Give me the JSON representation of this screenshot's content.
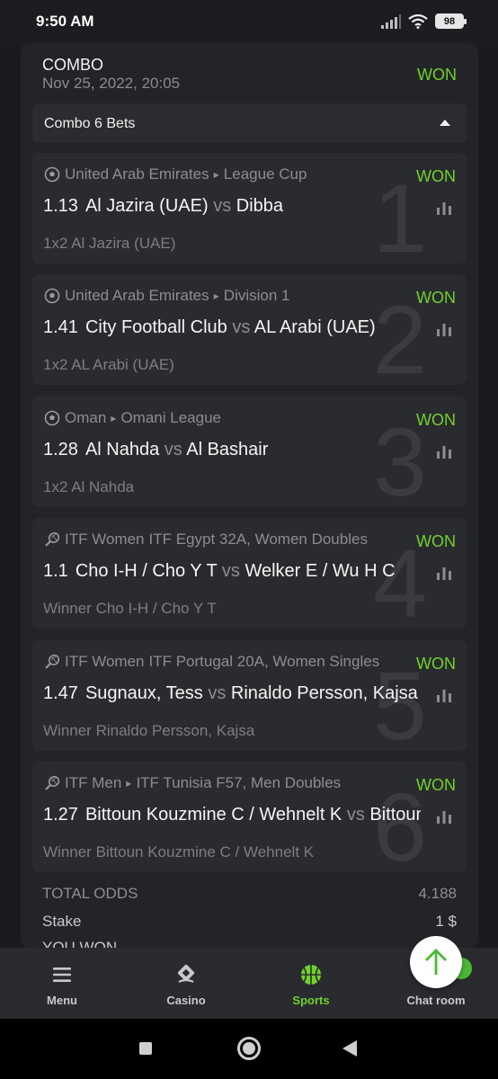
{
  "status": {
    "time": "9:50 AM",
    "battery": "98"
  },
  "combo": {
    "title": "COMBO",
    "date": "Nov 25, 2022, 20:05",
    "status": "WON",
    "bets_label": "Combo 6 Bets"
  },
  "bets": [
    {
      "number": "1",
      "sport_icon": "soccer-ball-icon",
      "country": "United Arab Emirates",
      "league": "League Cup",
      "status": "WON",
      "odd": "1.13",
      "home": "Al Jazira (UAE)",
      "vs": "vs",
      "away": "Dibba",
      "pick": "1x2 Al Jazira (UAE)"
    },
    {
      "number": "2",
      "sport_icon": "soccer-ball-icon",
      "country": "United Arab Emirates",
      "league": "Division 1",
      "status": "WON",
      "odd": "1.41",
      "home": "City Football Club",
      "vs": "vs",
      "away": "AL Arabi (UAE)",
      "pick": "1x2 AL Arabi (UAE)"
    },
    {
      "number": "3",
      "sport_icon": "soccer-ball-icon",
      "country": "Oman",
      "league": "Omani League",
      "status": "WON",
      "odd": "1.28",
      "home": "Al Nahda",
      "vs": "vs",
      "away": "Al Bashair",
      "pick": "1x2 Al Nahda"
    },
    {
      "number": "4",
      "sport_icon": "tennis-racket-icon",
      "country": "ITF Women",
      "league": "ITF Egypt 32A, Women Doubles",
      "status": "WON",
      "odd": "1.1",
      "home": "Cho I-H / Cho Y T",
      "vs": "vs",
      "away": "Welker E / Wu H C",
      "pick": "Winner Cho I-H / Cho Y T"
    },
    {
      "number": "5",
      "sport_icon": "tennis-racket-icon",
      "country": "ITF Women",
      "league": "ITF Portugal 20A, Women Singles",
      "status": "WON",
      "odd": "1.47",
      "home": "Sugnaux, Tess",
      "vs": "vs",
      "away": "Rinaldo Persson, Kajsa",
      "pick": "Winner Rinaldo Persson, Kajsa"
    },
    {
      "number": "6",
      "sport_icon": "tennis-racket-icon",
      "country": "ITF Men",
      "league": "ITF Tunisia F57, Men Doubles",
      "status": "WON",
      "odd": "1.27",
      "home": "Bittoun Kouzmine C / Wehnelt K",
      "vs": "vs",
      "away": "Bittoun Kouzmine C",
      "pick": "Winner Bittoun Kouzmine C / Wehnelt K"
    }
  ],
  "totals": {
    "odds_label": "TOTAL ODDS",
    "odds_value": "4.188",
    "stake_label": "Stake",
    "stake_value": "1 $",
    "won_label": "YOU WON"
  },
  "nav": {
    "menu": "Menu",
    "casino": "Casino",
    "sports": "Sports",
    "chat": "Chat room"
  },
  "colors": {
    "accent": "#6fd12c",
    "background": "#1a1b1e",
    "card": "#232428"
  }
}
